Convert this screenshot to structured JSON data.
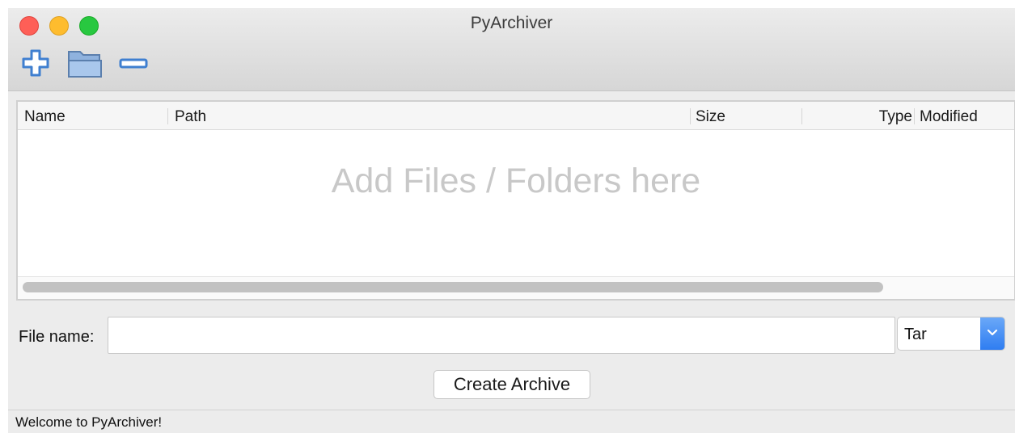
{
  "window": {
    "title": "PyArchiver"
  },
  "toolbar": {
    "add_icon": "plus-icon",
    "folder_icon": "folder-icon",
    "remove_icon": "minus-icon"
  },
  "table": {
    "columns": [
      "Name",
      "Path",
      "Size",
      "Type",
      "Modified"
    ],
    "placeholder": "Add Files / Folders here"
  },
  "form": {
    "file_name_label": "File name:",
    "file_name_value": "",
    "archive_type": "Tar",
    "create_button": "Create Archive"
  },
  "status": {
    "text": "Welcome to PyArchiver!"
  },
  "colors": {
    "accent": "#2f7df1",
    "icon_blue": "#4a8fde"
  }
}
